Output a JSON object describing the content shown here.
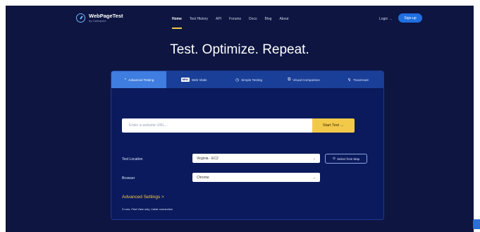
{
  "header": {
    "brand_name": "WebPageTest",
    "brand_sub": "by Catchpoint",
    "nav": [
      {
        "label": "Home",
        "active": true
      },
      {
        "label": "Test History",
        "active": false
      },
      {
        "label": "API",
        "active": false
      },
      {
        "label": "Forums",
        "active": false
      },
      {
        "label": "Docs",
        "active": false
      },
      {
        "label": "Blog",
        "active": false
      },
      {
        "label": "About",
        "active": false
      }
    ],
    "login_label": "Login →",
    "signup_label": "Sign-up"
  },
  "hero": {
    "headline": "Test. Optimize. Repeat."
  },
  "tabs": [
    {
      "label": "Advanced Testing",
      "icon": "gauge-icon",
      "active": true
    },
    {
      "label": "Web Vitals",
      "badge": "NEW",
      "active": false
    },
    {
      "label": "Simple Testing",
      "icon": "clock-icon",
      "active": false
    },
    {
      "label": "Visual Comparison",
      "icon": "compare-icon",
      "active": false
    },
    {
      "label": "Traceroute",
      "icon": "route-icon",
      "active": false
    }
  ],
  "form": {
    "url_placeholder": "Enter a website URL...",
    "start_label": "Start Test →",
    "location_label": "Test Location",
    "location_value": "Virginia - EC2",
    "map_button_label": "Select from Map",
    "browser_label": "Browser",
    "browser_value": "Chrome",
    "advanced_label": "Advanced Settings",
    "advanced_chevron": ">",
    "advanced_summary": "3 runs, First View only, Cable connection"
  },
  "colors": {
    "page_bg": "#0d1540",
    "tab_bar": "#1a3f98",
    "tab_active": "#3f7de0",
    "accent_yellow": "#f3c94a",
    "signup_blue": "#1f6fe0"
  }
}
